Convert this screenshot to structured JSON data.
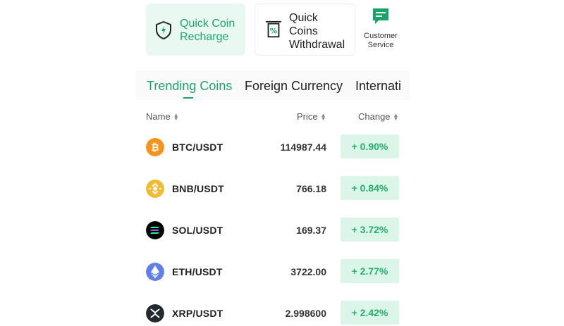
{
  "actions": {
    "recharge": {
      "line1": "Quick Coin",
      "line2": "Recharge"
    },
    "withdraw": {
      "line1": "Quick",
      "line2": "Coins",
      "line3": "Withdrawal"
    },
    "service": {
      "line1": "Customer",
      "line2": "Service"
    }
  },
  "tabs": [
    {
      "label": "Trending Coins",
      "active": true
    },
    {
      "label": "Foreign Currency"
    },
    {
      "label": "Internati"
    }
  ],
  "columns": {
    "name": "Name",
    "price": "Price",
    "change": "Change"
  },
  "rows": [
    {
      "pair": "BTC/USDT",
      "price": "114987.44",
      "change": "+ 0.90%",
      "icon": "bitcoin-icon"
    },
    {
      "pair": "BNB/USDT",
      "price": "766.18",
      "change": "+ 0.84%",
      "icon": "bnb-icon"
    },
    {
      "pair": "SOL/USDT",
      "price": "169.37",
      "change": "+ 3.72%",
      "icon": "solana-icon"
    },
    {
      "pair": "ETH/USDT",
      "price": "3722.00",
      "change": "+ 2.77%",
      "icon": "ethereum-icon"
    },
    {
      "pair": "XRP/USDT",
      "price": "2.998600",
      "change": "+ 2.42%",
      "icon": "xrp-icon"
    }
  ],
  "colors": {
    "accent": "#1aa568",
    "positive_bg": "#dcf5e9",
    "positive_text": "#22b06e"
  }
}
